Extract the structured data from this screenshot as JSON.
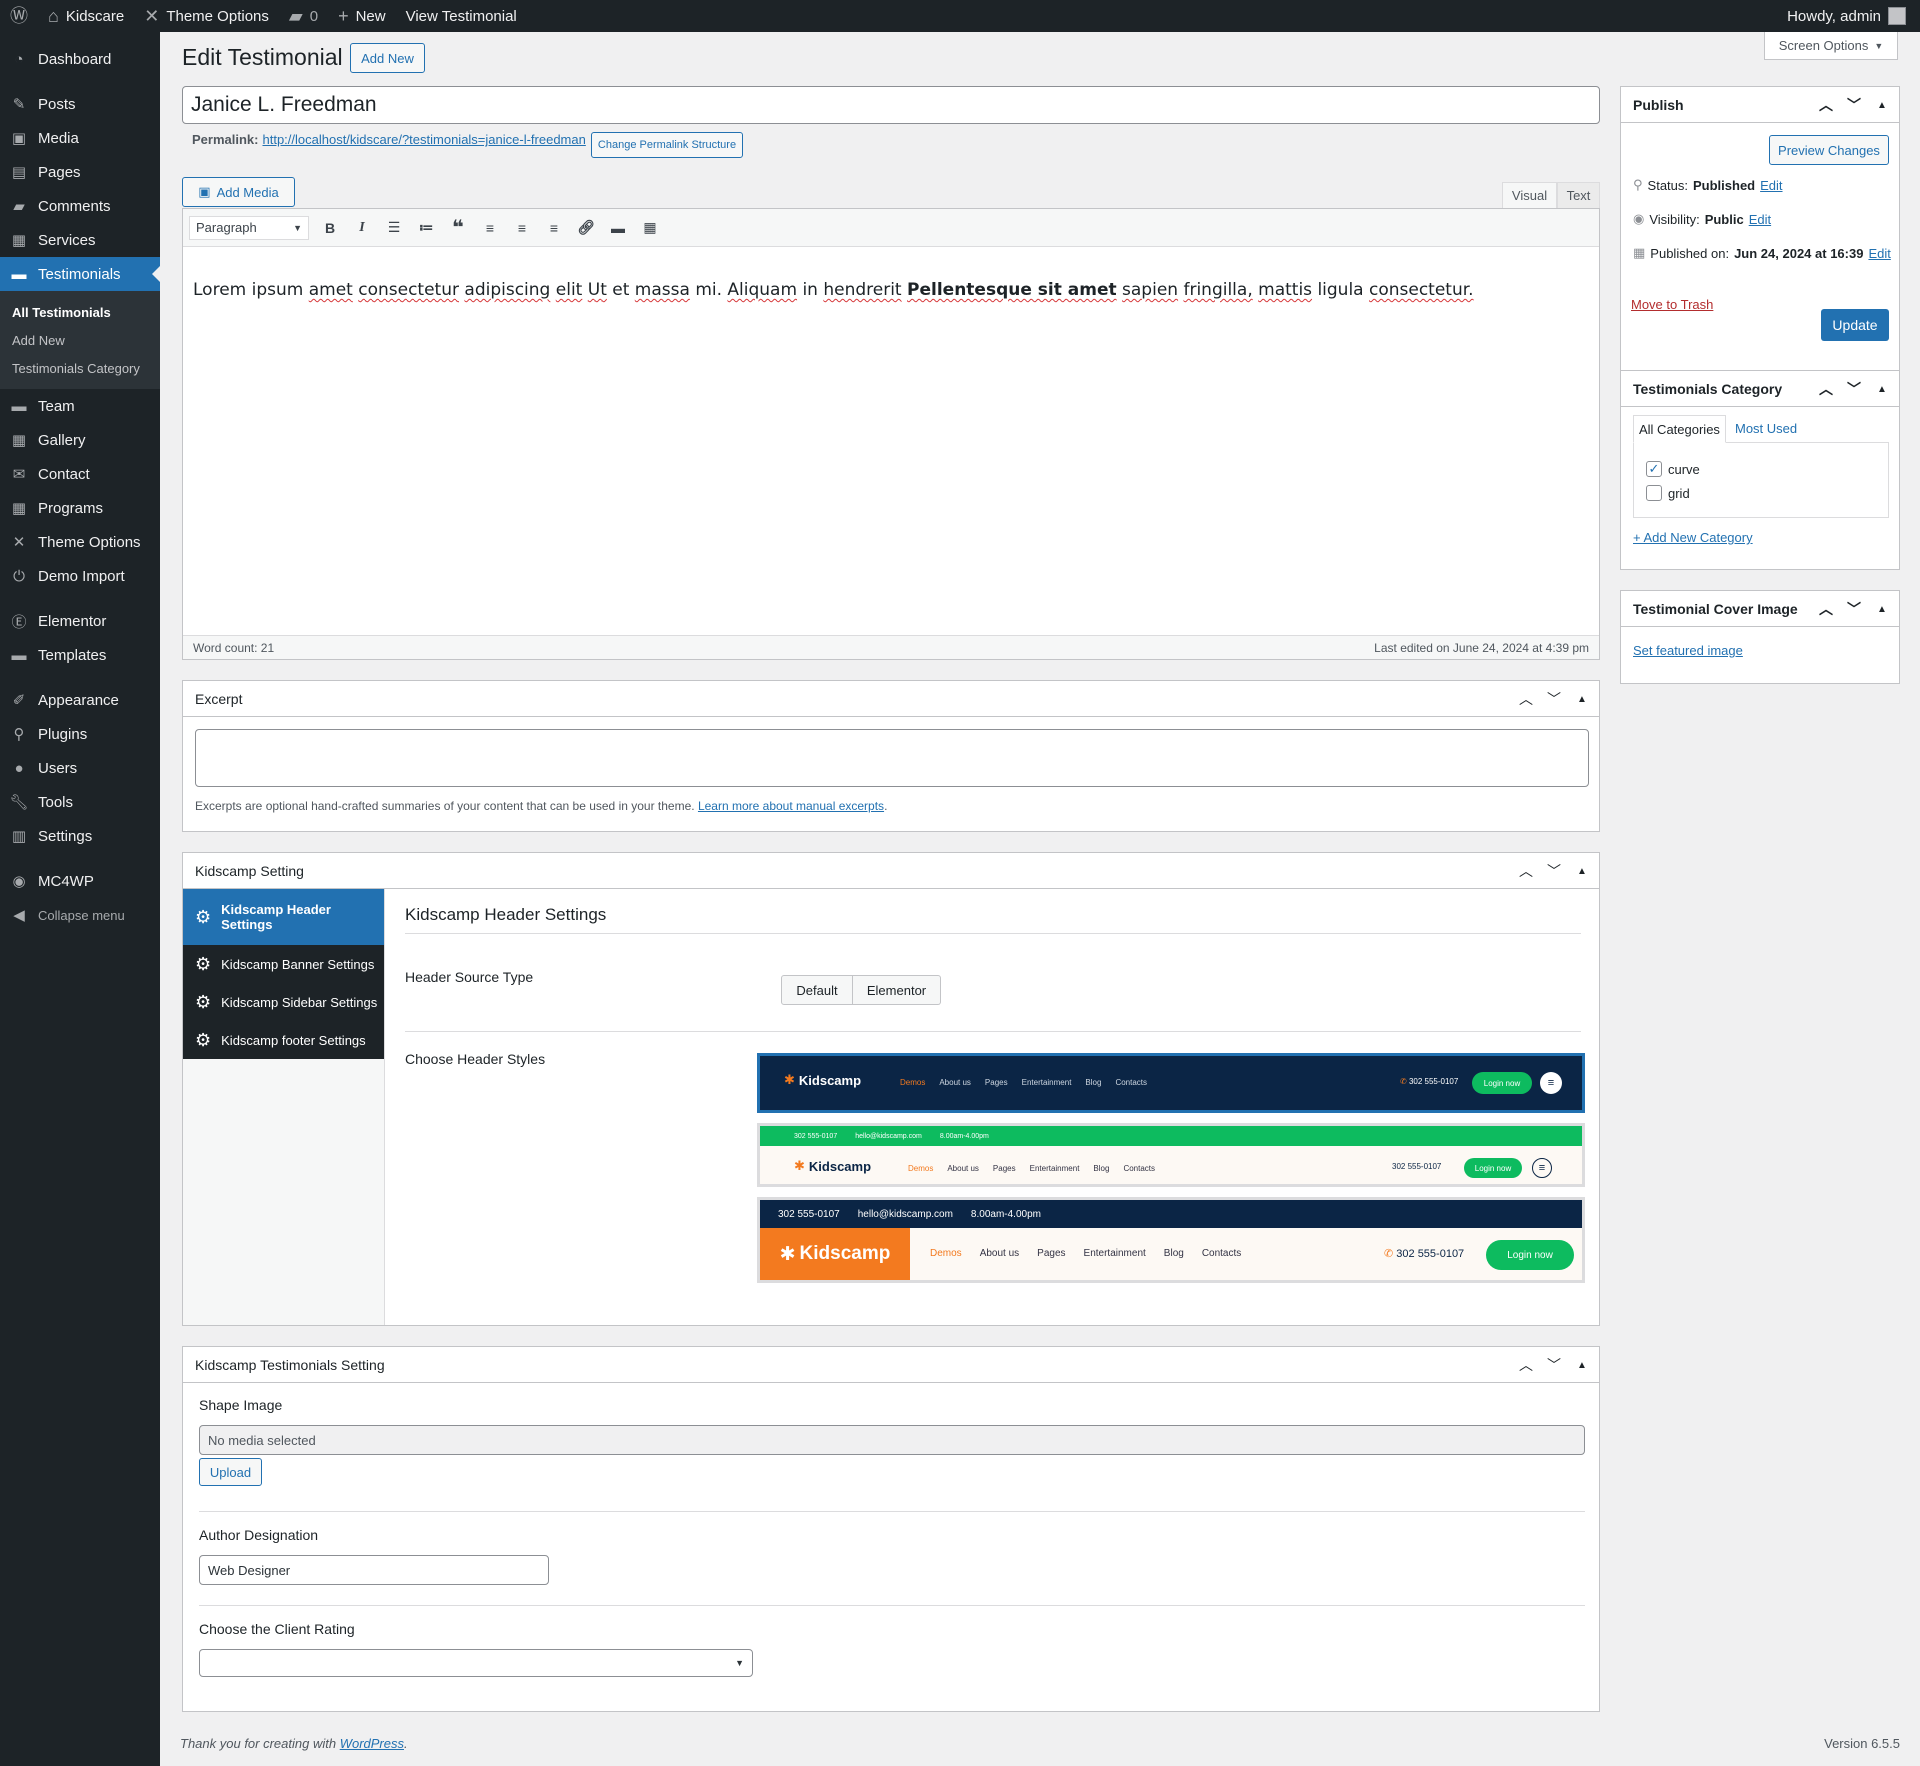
{
  "adminbar": {
    "site_name": "Kidscare",
    "theme_options": "Theme Options",
    "comments_count": "0",
    "new_label": "New",
    "view_label": "View Testimonial",
    "howdy": "Howdy, admin"
  },
  "sidebar": {
    "items": [
      {
        "label": "Dashboard",
        "icon": "dashboard-icon"
      },
      {
        "label": "Posts",
        "icon": "pin-icon"
      },
      {
        "label": "Media",
        "icon": "media-icon"
      },
      {
        "label": "Pages",
        "icon": "pages-icon"
      },
      {
        "label": "Comments",
        "icon": "comments-icon"
      },
      {
        "label": "Services",
        "icon": "briefcase-icon"
      },
      {
        "label": "Testimonials",
        "icon": "folder-icon"
      },
      {
        "label": "Team",
        "icon": "folder-icon"
      },
      {
        "label": "Gallery",
        "icon": "briefcase-icon"
      },
      {
        "label": "Contact",
        "icon": "mail-icon"
      },
      {
        "label": "Programs",
        "icon": "briefcase-icon"
      },
      {
        "label": "Theme Options",
        "icon": "tools-icon"
      },
      {
        "label": "Demo Import",
        "icon": "plug-icon"
      },
      {
        "label": "Elementor",
        "icon": "elementor-icon"
      },
      {
        "label": "Templates",
        "icon": "folder-icon"
      },
      {
        "label": "Appearance",
        "icon": "brush-icon"
      },
      {
        "label": "Plugins",
        "icon": "plugin-icon"
      },
      {
        "label": "Users",
        "icon": "user-icon"
      },
      {
        "label": "Tools",
        "icon": "wrench-icon"
      },
      {
        "label": "Settings",
        "icon": "settings-icon"
      },
      {
        "label": "MC4WP",
        "icon": "mc4wp-icon"
      }
    ],
    "submenu": [
      "All Testimonials",
      "Add New",
      "Testimonials Category"
    ],
    "collapse": "Collapse menu"
  },
  "page": {
    "heading": "Edit Testimonial",
    "add_new": "Add New",
    "screen_options": "Screen Options",
    "title_value": "Janice L. Freedman",
    "permalink_label": "Permalink:",
    "permalink_url": "http://localhost/kidscare/?testimonials=janice-l-freedman",
    "change_permalink": "Change Permalink Structure"
  },
  "editor": {
    "add_media": "Add Media",
    "tab_visual": "Visual",
    "tab_text": "Text",
    "format": "Paragraph",
    "content_parts": [
      "Lorem ipsum",
      "amet",
      "consectetur",
      "adipiscing",
      "elit",
      "Ut",
      "et",
      "massa",
      "mi.",
      "Aliquam",
      "in",
      "hendrerit",
      "Pellentesque sit amet",
      "sapien",
      "fringilla,",
      "mattis",
      "ligula",
      "consectetur."
    ],
    "word_count": "Word count: 21",
    "last_edited": "Last edited on June 24, 2024 at 4:39 pm"
  },
  "excerpt": {
    "title": "Excerpt",
    "help": "Excerpts are optional hand-crafted summaries of your content that can be used in your theme.",
    "help_link": "Learn more about manual excerpts",
    "value": ""
  },
  "kidscamp_setting": {
    "title": "Kidscamp Setting",
    "tabs": [
      "Kidscamp Header Settings",
      "Kidscamp Banner Settings",
      "Kidscamp Sidebar Settings",
      "Kidscamp footer Settings"
    ],
    "section_title": "Kidscamp Header Settings",
    "source_label": "Header Source Type",
    "source_options": [
      "Default",
      "Elementor"
    ],
    "styles_label": "Choose Header Styles",
    "preview": {
      "brand": "Kidscamp",
      "nav": [
        "Demos",
        "About us",
        "Pages",
        "Entertainment",
        "Blog",
        "Contacts"
      ],
      "phone": "302 555-0107",
      "email": "hello@kidscamp.com",
      "hours": "8.00am-4.00pm",
      "login": "Login now"
    }
  },
  "testimonials_setting": {
    "title": "Kidscamp Testimonials Setting",
    "shape_label": "Shape Image",
    "shape_value": "No media selected",
    "upload": "Upload",
    "designation_label": "Author Designation",
    "designation_value": "Web Designer",
    "rating_label": "Choose the Client Rating",
    "rating_value": ""
  },
  "publish": {
    "title": "Publish",
    "preview": "Preview Changes",
    "status_label": "Status:",
    "status_value": "Published",
    "visibility_label": "Visibility:",
    "visibility_value": "Public",
    "published_label": "Published on:",
    "published_value": "Jun 24, 2024 at 16:39",
    "edit": "Edit",
    "trash": "Move to Trash",
    "update": "Update"
  },
  "category": {
    "title": "Testimonials Category",
    "tab_all": "All Categories",
    "tab_used": "Most Used",
    "items": [
      {
        "label": "curve",
        "checked": true
      },
      {
        "label": "grid",
        "checked": false
      }
    ],
    "add_new": "+ Add New Category"
  },
  "cover": {
    "title": "Testimonial Cover Image",
    "link": "Set featured image"
  },
  "footer": {
    "thanks": "Thank you for creating with",
    "wp_link": "WordPress",
    "period": ".",
    "version": "Version 6.5.5"
  },
  "colors": {
    "accent": "#2271b1",
    "sidebar": "#1d2327",
    "preview_green": "#0dbb5f",
    "preview_orange": "#f37a1f",
    "preview_navy": "#0b2545"
  }
}
